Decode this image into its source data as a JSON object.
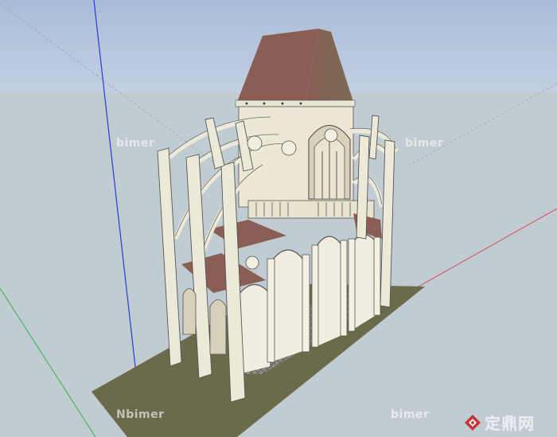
{
  "canvas": {
    "sky_color": "#b7c6de",
    "ground_color": "#c0ccd1",
    "base_color": "#6b6a4a",
    "stone_color": "#ede9d8",
    "roof_color": "#8a5e55"
  },
  "watermarks": [
    {
      "text": "bimer"
    },
    {
      "text": "bimer"
    },
    {
      "text": "Nbimer"
    },
    {
      "text": "bimer"
    }
  ],
  "logo": {
    "text": "定鼎网",
    "icon": "diamond-logo-icon",
    "color": "#c8333a"
  }
}
